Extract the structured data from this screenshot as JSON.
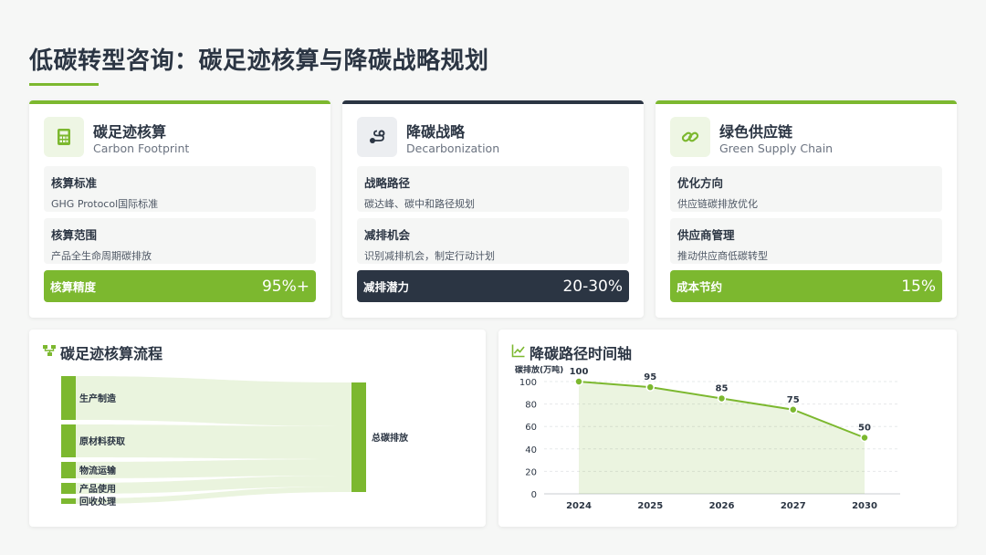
{
  "page": {
    "title": "低碳转型咨询：碳足迹核算与降碳战略规划"
  },
  "cards": [
    {
      "title": "碳足迹核算",
      "subtitle": "Carbon Footprint",
      "icon": "calculator-icon",
      "accent": "#7cb82f",
      "items": [
        {
          "label": "核算标准",
          "desc": "GHG Protocol国际标准"
        },
        {
          "label": "核算范围",
          "desc": "产品全生命周期碳排放"
        }
      ],
      "metric": {
        "label": "核算精度",
        "value": "95%+",
        "color": "#7cb82f"
      }
    },
    {
      "title": "降碳战略",
      "subtitle": "Decarbonization",
      "icon": "route-icon",
      "accent": "#2b3543",
      "items": [
        {
          "label": "战略路径",
          "desc": "碳达峰、碳中和路径规划"
        },
        {
          "label": "减排机会",
          "desc": "识别减排机会，制定行动计划"
        }
      ],
      "metric": {
        "label": "减排潜力",
        "value": "20-30%",
        "color": "#2b3543"
      }
    },
    {
      "title": "绿色供应链",
      "subtitle": "Green Supply Chain",
      "icon": "link-icon",
      "accent": "#7cb82f",
      "items": [
        {
          "label": "优化方向",
          "desc": "供应链碳排放优化"
        },
        {
          "label": "供应商管理",
          "desc": "推动供应商低碳转型"
        }
      ],
      "metric": {
        "label": "成本节约",
        "value": "15%",
        "color": "#7cb82f"
      }
    }
  ],
  "flow": {
    "title": "碳足迹核算流程",
    "icon": "flow-icon",
    "sources": [
      {
        "label": "生产制造",
        "value": 40
      },
      {
        "label": "原材料获取",
        "value": 30
      },
      {
        "label": "物流运输",
        "value": 15
      },
      {
        "label": "产品使用",
        "value": 10
      },
      {
        "label": "回收处理",
        "value": 5
      }
    ],
    "target": "总碳排放"
  },
  "timeline": {
    "title": "降碳路径时间轴",
    "icon": "line-chart-icon"
  },
  "chart_data": {
    "type": "line",
    "ylabel": "碳排放(万吨)",
    "categories": [
      "2024",
      "2025",
      "2026",
      "2027",
      "2030"
    ],
    "series": [
      {
        "values": [
          100,
          95,
          85,
          75,
          50
        ]
      }
    ],
    "data_labels": [
      "100",
      "95",
      "85",
      "75",
      "50"
    ],
    "ylim": [
      0,
      100
    ],
    "yticks": [
      "0",
      "20",
      "40",
      "60",
      "80",
      "100"
    ],
    "grid": true,
    "area_fill": true,
    "color": "#7cb82f"
  }
}
